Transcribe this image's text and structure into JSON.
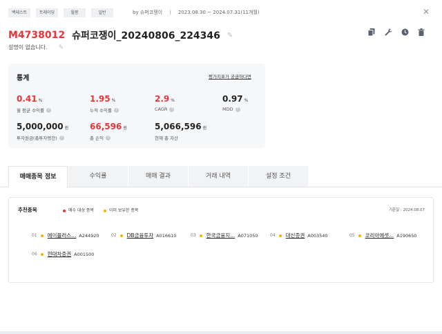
{
  "header": {
    "tags": [
      "백테스트",
      "트레이딩",
      "월봉",
      "일반"
    ],
    "author": "by 슈퍼코쟁이",
    "separator": "|",
    "period": "2023.08.30 ~ 2024.07.31(11개월)",
    "close_glyph": "✕"
  },
  "title": {
    "code": "M4738012",
    "name": "슈퍼코쟁이_20240806_224346",
    "description": "설명이 없습니다."
  },
  "tools": [
    "copy-icon",
    "wrench-icon",
    "clock-icon",
    "trash-icon"
  ],
  "stats": {
    "title": "통계",
    "help_link": "평가지표가 궁금하다면",
    "items": [
      {
        "value": "0.41",
        "unit": "%",
        "label": "월 평균 수익률",
        "color": "red"
      },
      {
        "value": "1.95",
        "unit": "%",
        "label": "누적 수익률",
        "color": "red"
      },
      {
        "value": "2.9",
        "unit": "%",
        "label": "CAGR",
        "color": "red"
      },
      {
        "value": "0.97",
        "unit": "%",
        "label": "MDD",
        "color": "black"
      },
      {
        "value": "5,000,000",
        "unit": "원",
        "label": "투자원금(총투자평잔)",
        "color": "black"
      },
      {
        "value": "66,596",
        "unit": "원",
        "label": "총 손익",
        "color": "red"
      },
      {
        "value": "5,066,596",
        "unit": "원",
        "label": "현재 총 자산",
        "color": "black"
      }
    ]
  },
  "tabs": [
    "매매종목 정보",
    "수익률",
    "매매 결과",
    "거래 내역",
    "설정 조건"
  ],
  "recommend": {
    "title": "추천종목",
    "legend_buy": "매수 대상 종목",
    "legend_hold": "이미 보유한 종목",
    "base_date": "기준일 : 2024.08.07",
    "items": [
      {
        "num": "01",
        "name": "에이플러스...",
        "code": "A244920"
      },
      {
        "num": "02",
        "name": "DB금융투자",
        "code": "A016610"
      },
      {
        "num": "03",
        "name": "한국금융지...",
        "code": "A071050"
      },
      {
        "num": "04",
        "name": "대신증권",
        "code": "A003540"
      },
      {
        "num": "05",
        "name": "코리아에셋...",
        "code": "A190650"
      },
      {
        "num": "06",
        "name": "현대차증권",
        "code": "A001500"
      }
    ]
  },
  "colors": {
    "red": "#e8343a",
    "buy_dot": "#e8343a",
    "hold_dot": "#f5b400"
  }
}
